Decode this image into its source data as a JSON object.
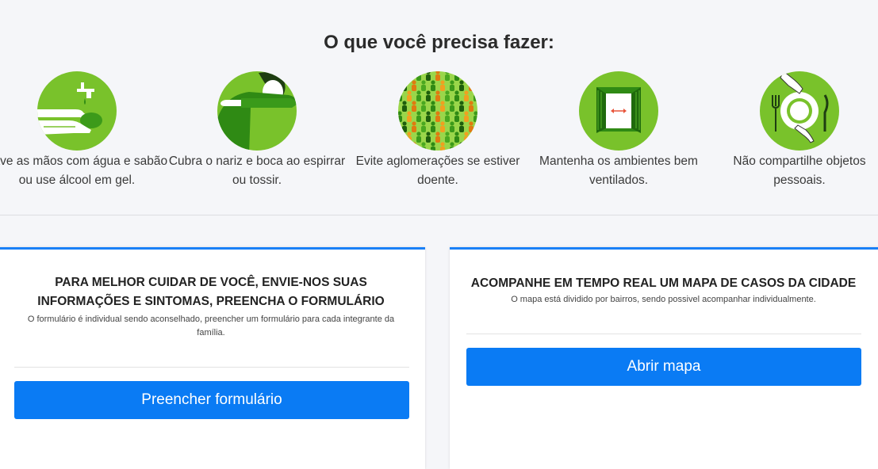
{
  "section": {
    "title": "O que você precisa fazer:"
  },
  "tips": [
    {
      "icon": "handwashing-icon",
      "text": "Lave as mãos com água e sabão ou use álcool em gel."
    },
    {
      "icon": "cough-into-elbow-icon",
      "text": "Cubra o nariz e boca ao espirrar ou tossir."
    },
    {
      "icon": "crowd-icon",
      "text": "Evite aglomerações se estiver doente."
    },
    {
      "icon": "open-window-icon",
      "text": "Mantenha os ambientes bem ventilados."
    },
    {
      "icon": "dishes-icon",
      "text": "Não compartilhe objetos pessoais."
    }
  ],
  "colors": {
    "icon_bg": "#79c22b",
    "primary": "#0a7bf4",
    "card_accent": "#1a80f7"
  },
  "form_card": {
    "title": "PARA MELHOR CUIDAR DE VOCÊ, ENVIE-NOS SUAS INFORMAÇÕES E SINTOMAS, PREENCHA O FORMULÁRIO",
    "text": "O formulário é individual sendo aconselhado, preencher um formulário para cada integrante da família.",
    "button": "Preencher formulário"
  },
  "map_card": {
    "title": "ACOMPANHE EM TEMPO REAL UM MAPA DE CASOS DA CIDADE",
    "text": "O mapa está dividido por bairros, sendo possivel acompanhar individualmente.",
    "button": "Abrir mapa"
  }
}
